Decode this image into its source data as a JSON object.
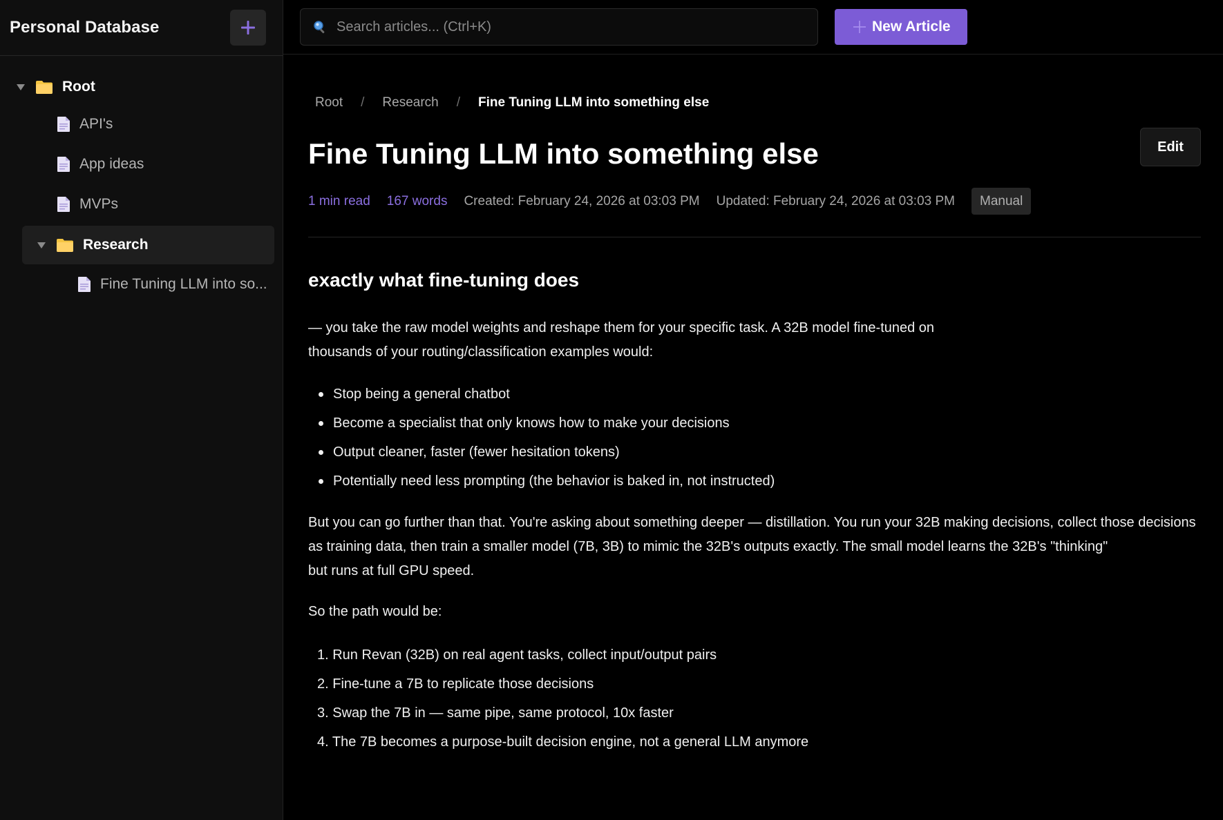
{
  "sidebar": {
    "title": "Personal Database",
    "tree": {
      "root_label": "Root",
      "root_children": [
        "API's",
        "App ideas",
        "MVPs"
      ],
      "folder_label": "Research",
      "folder_children": [
        "Fine Tuning LLM into so..."
      ]
    }
  },
  "topbar": {
    "search_placeholder": "Search articles... (Ctrl+K)",
    "new_article_label": "New Article"
  },
  "breadcrumb": {
    "items": [
      "Root",
      "Research"
    ],
    "separator": "/",
    "current": "Fine Tuning LLM into something else"
  },
  "article": {
    "title": "Fine Tuning LLM into something else",
    "edit_label": "Edit",
    "meta": {
      "read_time": "1 min read",
      "words": "167 words",
      "created": "Created: February 24, 2026 at 03:03 PM",
      "updated": "Updated: February 24, 2026 at 03:03 PM",
      "badge": "Manual"
    },
    "heading": "exactly what fine-tuning does",
    "intro_line1": "— you take the raw model weights and reshape them for your specific task. A 32B model fine-tuned on",
    "intro_line2": "thousands of your routing/classification examples would:",
    "bullets": [
      "Stop being a general chatbot",
      "Become a specialist that only knows how to make your decisions",
      "Output cleaner, faster (fewer hesitation tokens)",
      "Potentially need less prompting (the behavior is baked in, not instructed)"
    ],
    "para2_line1": "But you can go further than that. You're asking about something deeper — distillation. You run your 32B making decisions, collect those decisions as training data, then train a smaller model (7B, 3B) to mimic the 32B's outputs exactly. The small model learns the 32B's \"thinking\"",
    "para2_line2": "but runs at full GPU speed.",
    "para3": "So the path would be:",
    "steps": [
      "1. Run Revan (32B) on real agent tasks, collect input/output pairs",
      "2. Fine-tune a 7B to replicate those decisions",
      "3. Swap the 7B in — same pipe, same protocol, 10x faster",
      "4. The 7B becomes a purpose-built decision engine, not a general LLM anymore"
    ]
  },
  "colors": {
    "accent": "#7c5cd6",
    "accent_text": "#8b6fe0",
    "folder": "#f5c542",
    "background": "#000000",
    "sidebar": "#0f0f0f"
  },
  "icons": {
    "add": "plus-icon",
    "search": "search-icon",
    "folder": "folder-icon",
    "document": "document-icon",
    "caret": "caret-down-icon"
  }
}
